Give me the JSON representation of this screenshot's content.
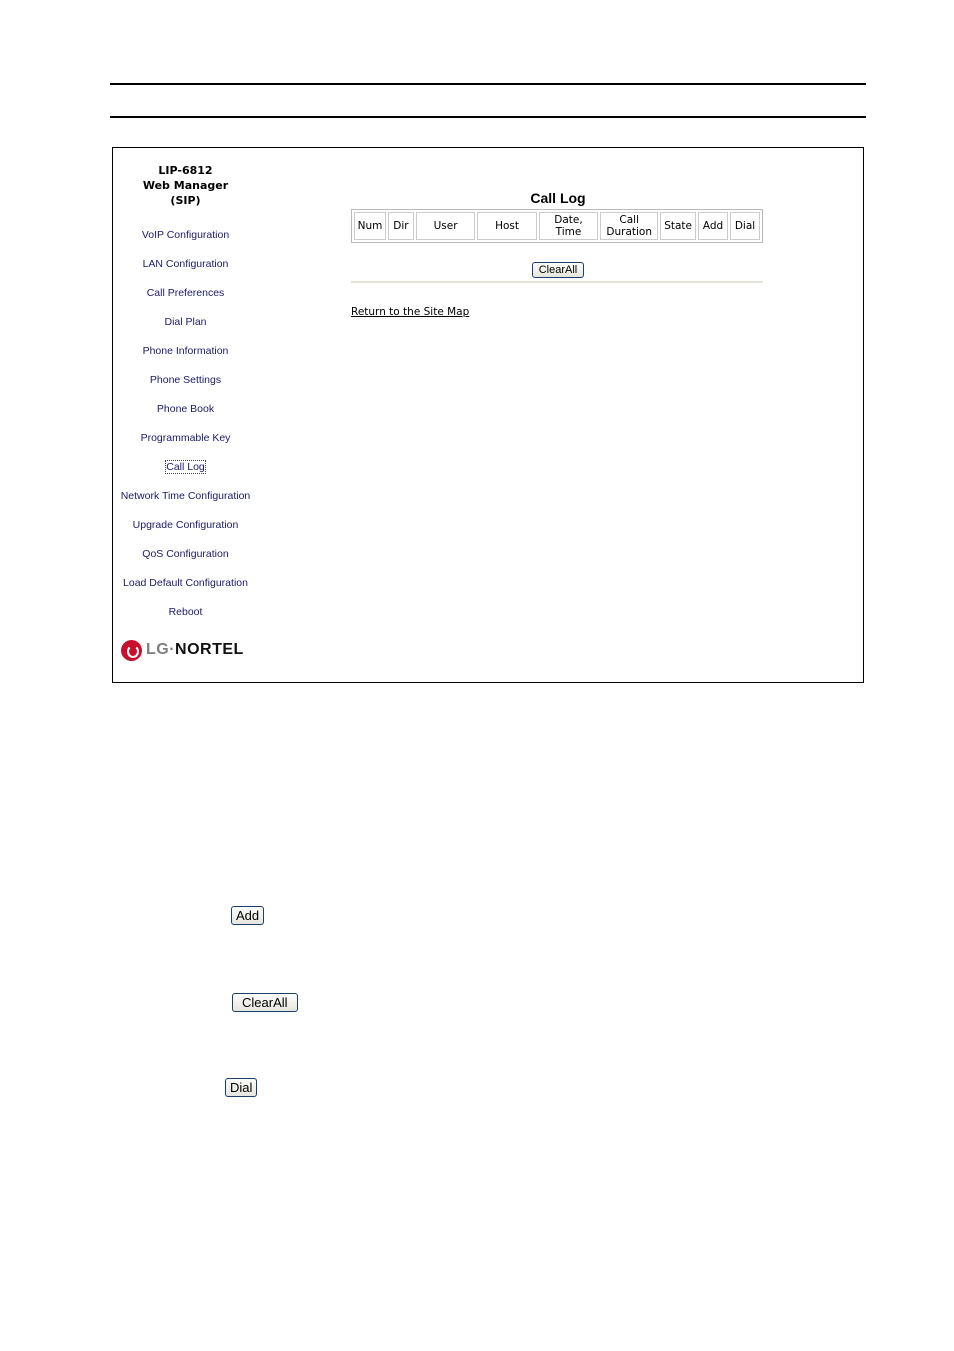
{
  "app": {
    "title_lines": [
      "LIP-6812",
      "Web Manager",
      "(SIP)"
    ]
  },
  "sidebar": {
    "items": [
      {
        "label": "VoIP Configuration"
      },
      {
        "label": "LAN Configuration"
      },
      {
        "label": "Call Preferences"
      },
      {
        "label": "Dial Plan"
      },
      {
        "label": "Phone Information"
      },
      {
        "label": "Phone Settings"
      },
      {
        "label": "Phone Book"
      },
      {
        "label": "Programmable Key"
      },
      {
        "label": "Call Log",
        "active": true
      },
      {
        "label": "Network Time Configuration"
      },
      {
        "label": "Upgrade Configuration"
      },
      {
        "label": "QoS Configuration"
      },
      {
        "label": "Load Default Configuration"
      },
      {
        "label": "Reboot"
      }
    ],
    "logo": {
      "lg": "LG",
      "sep": "·",
      "nortel": "NORTEL"
    }
  },
  "main": {
    "title": "Call Log",
    "columns": [
      [
        "Num"
      ],
      [
        "Dir"
      ],
      [
        "User"
      ],
      [
        "Host"
      ],
      [
        "Date,",
        "Time"
      ],
      [
        "Call",
        "Duration"
      ],
      [
        "State"
      ],
      [
        "Add"
      ],
      [
        "Dial"
      ]
    ],
    "clear_all_label": "ClearAll",
    "return_link": "Return to the Site Map"
  },
  "document": {
    "add_button": "Add",
    "clearall_button": "ClearAll",
    "dial_button": "Dial"
  }
}
